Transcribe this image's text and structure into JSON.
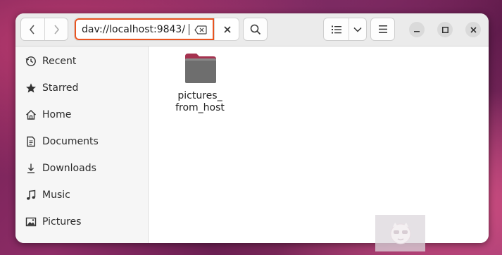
{
  "header": {
    "location": "dav://localhost:9843/"
  },
  "icons": {
    "back": "chevron-left-icon",
    "forward": "chevron-right-icon",
    "clear": "backspace-clear-icon",
    "close_entry": "close-icon",
    "search": "search-icon",
    "view": "list-view-icon",
    "view_dropdown": "chevron-down-icon",
    "menu": "hamburger-menu-icon",
    "minimize": "minimize-icon",
    "maximize": "maximize-icon",
    "close_window": "close-icon"
  },
  "sidebar": {
    "items": [
      {
        "label": "Recent",
        "icon": "clock-icon"
      },
      {
        "label": "Starred",
        "icon": "star-icon"
      },
      {
        "label": "Home",
        "icon": "home-icon"
      },
      {
        "label": "Documents",
        "icon": "document-icon"
      },
      {
        "label": "Downloads",
        "icon": "download-icon"
      },
      {
        "label": "Music",
        "icon": "music-icon"
      },
      {
        "label": "Pictures",
        "icon": "picture-icon"
      }
    ]
  },
  "files": [
    {
      "name": "pictures_\nfrom_host",
      "type": "folder"
    }
  ],
  "colors": {
    "accent": "#e95420",
    "folder_body": "#6e6e6e",
    "folder_tab": "#a5324f",
    "window_bg": "#fafafa",
    "sidebar_bg": "#f6f6f6"
  }
}
